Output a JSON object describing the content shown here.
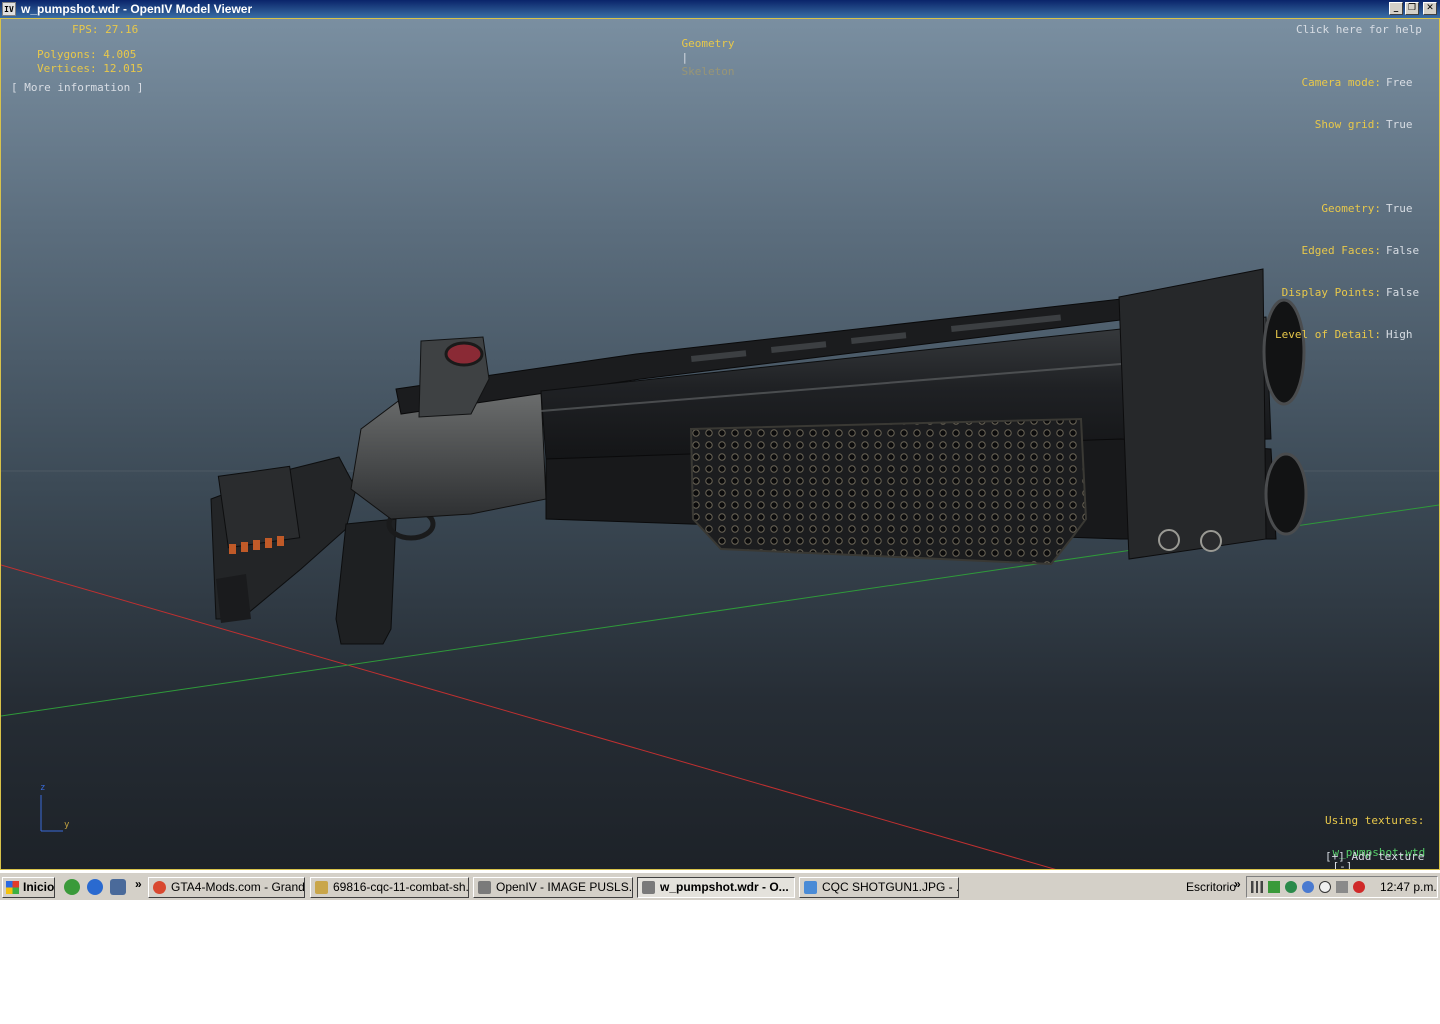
{
  "window": {
    "app_icon_text": "IV",
    "title": "w_pumpshot.wdr - OpenIV Model Viewer",
    "min_glyph": "_",
    "restore_glyph": "❐",
    "close_glyph": "✕"
  },
  "overlay": {
    "fps": "FPS: 27.16",
    "polygons": "Polygons: 4.005",
    "vertices": "Vertices: 12.015",
    "more_info": "[ More information ]",
    "mode_geometry": "Geometry",
    "mode_sep": "|",
    "mode_skeleton": "Skeleton",
    "help": "Click here for help",
    "settings": [
      {
        "label": "Camera mode:",
        "value": "Free"
      },
      {
        "label": "Show grid:",
        "value": "True"
      },
      {
        "label": "",
        "value": ""
      },
      {
        "label": "Geometry:",
        "value": "True"
      },
      {
        "label": "Edged Faces:",
        "value": "False"
      },
      {
        "label": "Display Points:",
        "value": "False"
      },
      {
        "label": "Level of Detail:",
        "value": "High"
      }
    ],
    "axis_z": "z",
    "axis_y": "y",
    "using_textures": "Using textures:",
    "texture_file": "w_pumpshot.wtd",
    "texture_remove": "[-]",
    "add_texture": "[+] Add texture"
  },
  "taskbar": {
    "start_label": "Inicio",
    "overflow_glyph": "»",
    "buttons": [
      {
        "label": "GTA4-Mods.com - Grand ...",
        "icon_color": "#d9482f"
      },
      {
        "label": "69816-cqc-11-combat-sh...",
        "icon_color": "#c9a64a"
      },
      {
        "label": "OpenIV - IMAGE PUSLS...",
        "icon_color": "#7a7a7a"
      },
      {
        "label": "w_pumpshot.wdr - O...",
        "icon_color": "#7a7a7a"
      },
      {
        "label": "CQC SHOTGUN1.JPG - ...",
        "icon_color": "#4a8bd6"
      }
    ],
    "desktop_label": "Escritorio",
    "clock": "12:47 p.m."
  },
  "colors": {
    "overlay_yellow": "#e8c84a",
    "overlay_text": "#d8dde4",
    "grid_x_axis": "#c03030",
    "grid_y_axis": "#2f9a3a",
    "taskbar_bg": "#d4d0c8"
  }
}
